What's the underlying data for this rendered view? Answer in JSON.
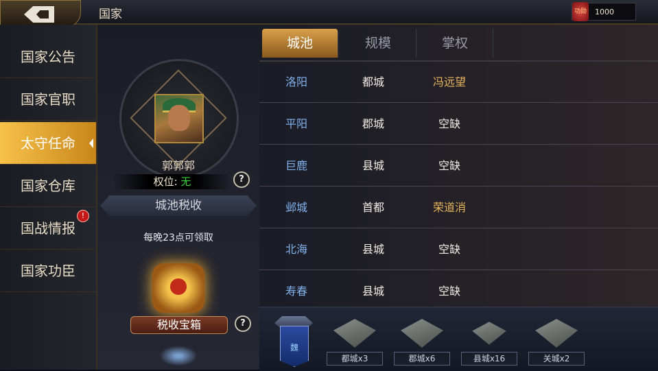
{
  "header": {
    "title": "国家",
    "resource_value": "1000",
    "resource_icon_text": "功勋",
    "back_icon": "back-arrow-icon"
  },
  "sidebar": {
    "items": [
      {
        "label": "国家公告"
      },
      {
        "label": "国家官职"
      },
      {
        "label": "太守任命",
        "active": true
      },
      {
        "label": "国家仓库"
      },
      {
        "label": "国战情报",
        "badge": "!"
      },
      {
        "label": "国家功臣"
      }
    ]
  },
  "profile": {
    "name": "郭郭郭",
    "rank_label": "权位:",
    "rank_value": "无",
    "help": "?"
  },
  "tax": {
    "header": "城池税收",
    "note": "每晚23点可领取",
    "chest_button": "税收宝箱",
    "help": "?"
  },
  "tabs": [
    {
      "label": "城池",
      "active": true
    },
    {
      "label": "规模"
    },
    {
      "label": "掌权"
    }
  ],
  "cities": [
    {
      "name": "洛阳",
      "type": "都城",
      "holder": "冯远望",
      "holder_gold": true
    },
    {
      "name": "平阳",
      "type": "郡城",
      "holder": "空缺"
    },
    {
      "name": "巨鹿",
      "type": "县城",
      "holder": "空缺"
    },
    {
      "name": "邺城",
      "type": "首都",
      "holder": "荣道消",
      "holder_gold": true
    },
    {
      "name": "北海",
      "type": "县城",
      "holder": "空缺"
    },
    {
      "name": "寿春",
      "type": "县城",
      "holder": "空缺"
    }
  ],
  "summary": {
    "faction": "魏",
    "counts": [
      {
        "label": "都城x3"
      },
      {
        "label": "郡城x6"
      },
      {
        "label": "县城x16"
      },
      {
        "label": "关城x2"
      }
    ]
  },
  "colors": {
    "accent": "#d8a04a",
    "city_name": "#7fb2ee",
    "holder_gold": "#e8b45c",
    "rank_value": "#39d339"
  }
}
